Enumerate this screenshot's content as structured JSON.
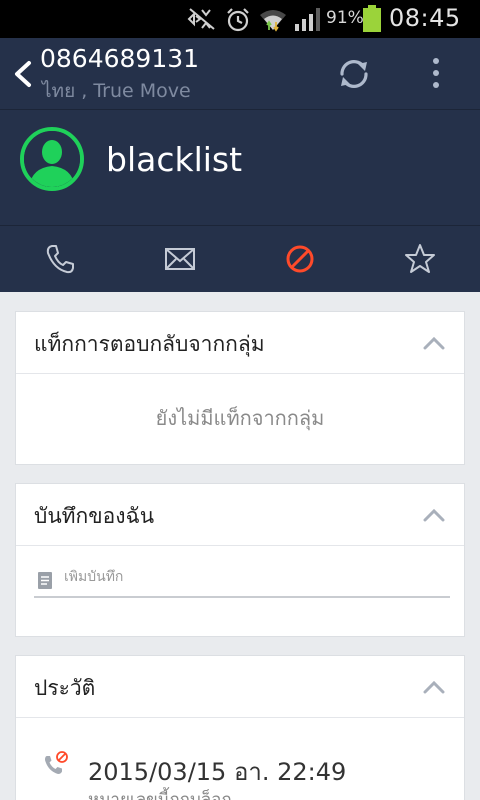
{
  "status_bar": {
    "battery_percent": "91%",
    "time": "08:45",
    "icons": [
      "mute-icon",
      "alarm-icon",
      "wifi-icon",
      "signal-icon",
      "battery-icon"
    ],
    "battery_level": 0.91
  },
  "header": {
    "phone_number": "0864689131",
    "carrier": "ไทย , True Move",
    "contact_name": "blacklist",
    "icons": [
      "back-icon",
      "refresh-icon",
      "overflow-icon",
      "avatar"
    ]
  },
  "actions": {
    "items": [
      "call-icon",
      "message-icon",
      "block-icon",
      "favorite-icon"
    ],
    "colors": {
      "default": "#c5cbd6",
      "block": "#ff4a2a"
    }
  },
  "group_tags": {
    "title": "แท็กการตอบกลับจากกลุ่ม",
    "empty_text": "ยังไม่มีแท็กจากกลุ่ม"
  },
  "my_notes": {
    "title": "บันทึกของฉัน",
    "placeholder": "เพิ่มบันทึก"
  },
  "history": {
    "title": "ประวัติ",
    "entries": [
      {
        "datetime": "2015/03/15 อา. 22:49",
        "label": "หมายเลขนี้ถูกบล็อก"
      }
    ]
  },
  "colors": {
    "header_bg": "#25314a",
    "accent_green": "#1fd15a",
    "page_bg": "#e9ebee"
  }
}
